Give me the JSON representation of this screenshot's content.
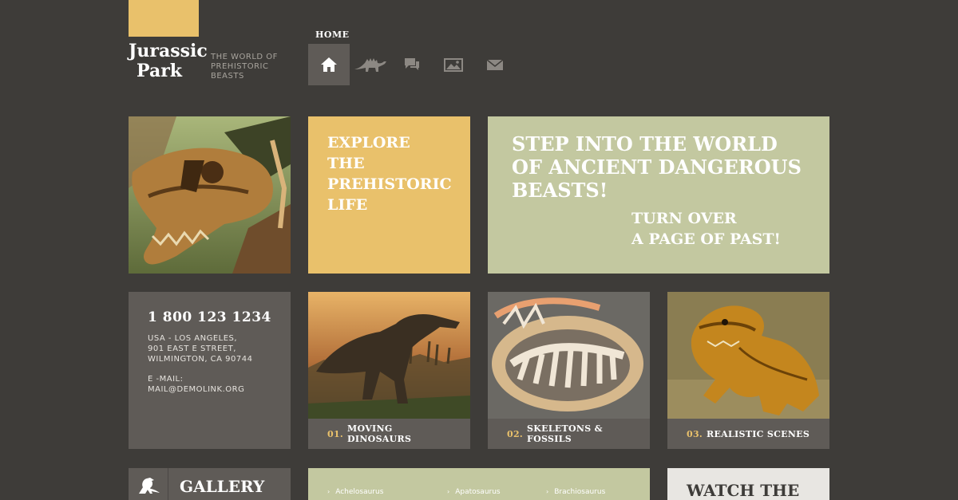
{
  "logo": {
    "line1": "Jurassic",
    "line2": "Park",
    "tagline": "THE WORLD OF PREHISTORIC BEASTS",
    "accent_color": "#e9c16b"
  },
  "nav": {
    "active_label": "HOME",
    "items": [
      {
        "icon": "home-icon",
        "active": true
      },
      {
        "icon": "dinosaur-icon",
        "active": false
      },
      {
        "icon": "speech-bubbles-icon",
        "active": false
      },
      {
        "icon": "picture-icon",
        "active": false
      },
      {
        "icon": "envelope-icon",
        "active": false
      }
    ]
  },
  "explore": {
    "text": "EXPLORE THE PREHISTORIC LIFE",
    "color": "#e9c16b"
  },
  "hero": {
    "title": "STEP INTO THE WORLD OF ANCIENT DANGEROUS BEASTS!",
    "subtitle_line1": "TURN OVER",
    "subtitle_line2": "A PAGE OF PAST!",
    "color": "#c3c8a0"
  },
  "contact": {
    "phone": "1 800 123 1234",
    "addr1": "USA - LOS ANGELES,",
    "addr2": "901 EAST E STREET,",
    "addr3": "WILMINGTON, CA 90744",
    "email_label": "E -MAIL:",
    "email": "MAIL@DEMOLINK.ORG"
  },
  "features": [
    {
      "num": "01.",
      "label": "MOVING DINOSAURS"
    },
    {
      "num": "02.",
      "label": "SKELETONS & FOSSILS"
    },
    {
      "num": "03.",
      "label": "REALISTIC SCENES"
    }
  ],
  "gallery": {
    "title": "GALLERY"
  },
  "species": [
    "Achelosaurus",
    "Apatosaurus",
    "Brachiosaurus"
  ],
  "watch": {
    "title": "WATCH THE"
  }
}
